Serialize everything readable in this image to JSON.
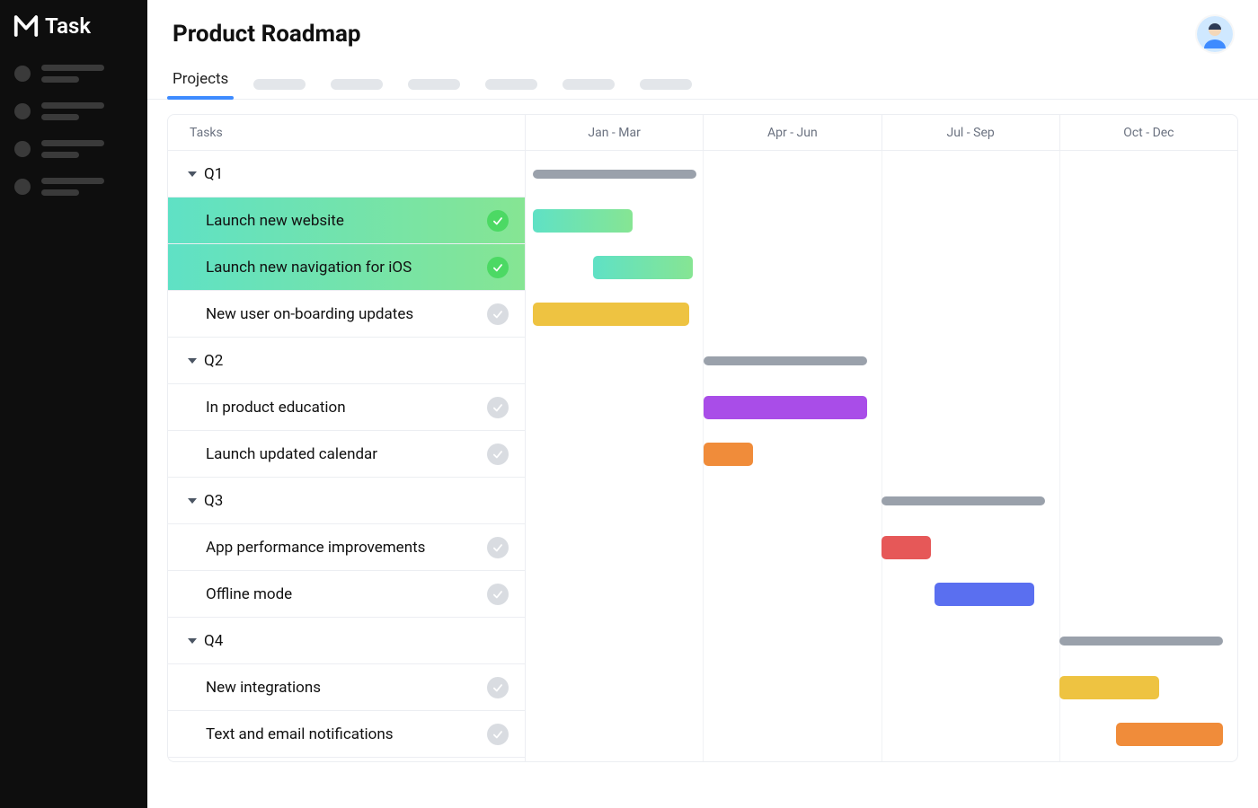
{
  "app_name": "Task",
  "header": {
    "title": "Product Roadmap"
  },
  "tabs": {
    "active": "Projects"
  },
  "tasks_header": "Tasks",
  "timeline_headers": [
    "Jan - Mar",
    "Apr - Jun",
    "Jul - Sep",
    "Oct - Dec"
  ],
  "groups": [
    {
      "label": "Q1",
      "bar": {
        "start_pct": 1,
        "width_pct": 23,
        "kind": "group"
      },
      "tasks": [
        {
          "label": "Launch new website",
          "status": "done",
          "highlight": true,
          "bar": {
            "start_pct": 1,
            "width_pct": 14,
            "color": "gradient-green"
          }
        },
        {
          "label": "Launch new navigation for iOS",
          "status": "done",
          "highlight": true,
          "bar": {
            "start_pct": 9.5,
            "width_pct": 14,
            "color": "gradient-green"
          }
        },
        {
          "label": "New user on-boarding updates",
          "status": "pending",
          "highlight": false,
          "bar": {
            "start_pct": 1,
            "width_pct": 22,
            "color": "#eec341"
          }
        }
      ]
    },
    {
      "label": "Q2",
      "bar": {
        "start_pct": 25,
        "width_pct": 23,
        "kind": "group"
      },
      "tasks": [
        {
          "label": "In product education",
          "status": "pending",
          "highlight": false,
          "bar": {
            "start_pct": 25,
            "width_pct": 23,
            "color": "#a94de8"
          }
        },
        {
          "label": "Launch updated calendar",
          "status": "pending",
          "highlight": false,
          "bar": {
            "start_pct": 25,
            "width_pct": 7,
            "color": "#f08c3a"
          }
        }
      ]
    },
    {
      "label": "Q3",
      "bar": {
        "start_pct": 50,
        "width_pct": 23,
        "kind": "group"
      },
      "tasks": [
        {
          "label": "App performance improvements",
          "status": "pending",
          "highlight": false,
          "bar": {
            "start_pct": 50,
            "width_pct": 7,
            "color": "#e65858"
          }
        },
        {
          "label": "Offline mode",
          "status": "pending",
          "highlight": false,
          "bar": {
            "start_pct": 57.5,
            "width_pct": 14,
            "color": "#5a6ff0"
          }
        }
      ]
    },
    {
      "label": "Q4",
      "bar": {
        "start_pct": 75,
        "width_pct": 23,
        "kind": "group"
      },
      "tasks": [
        {
          "label": "New integrations",
          "status": "pending",
          "highlight": false,
          "bar": {
            "start_pct": 75,
            "width_pct": 14,
            "color": "#eec341"
          }
        },
        {
          "label": "Text  and email notifications",
          "status": "pending",
          "highlight": false,
          "bar": {
            "start_pct": 83,
            "width_pct": 15,
            "color": "#f08c3a"
          }
        }
      ]
    }
  ],
  "colors": {
    "gradient_green_start": "#5fe1c5",
    "gradient_green_end": "#86e593",
    "group_bar": "#9aa1ab"
  }
}
